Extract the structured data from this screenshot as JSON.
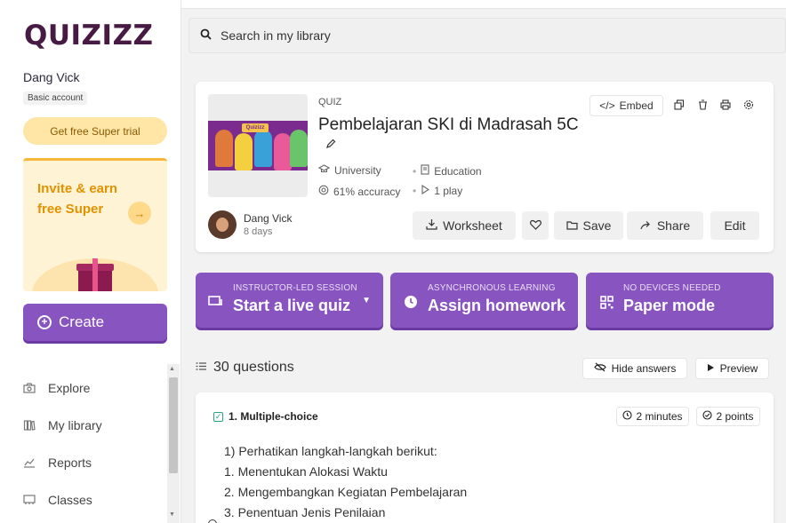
{
  "sidebar": {
    "logo": "QUIZIZZ",
    "user_name": "Dang Vick",
    "account_type": "Basic account",
    "trial_button": "Get free Super trial",
    "invite_text": "Invite & earn free Super",
    "create_button": "Create",
    "nav": [
      {
        "label": "Explore",
        "icon": "compass-icon"
      },
      {
        "label": "My library",
        "icon": "library-icon"
      },
      {
        "label": "Reports",
        "icon": "reports-icon"
      },
      {
        "label": "Classes",
        "icon": "classes-icon"
      }
    ]
  },
  "search": {
    "placeholder": "Search in my library"
  },
  "quiz": {
    "type": "QUIZ",
    "title": "Pembelajaran SKI di Madrasah 5C",
    "grade": "University",
    "subject": "Education",
    "accuracy": "61% accuracy",
    "plays": "1 play",
    "thumbnail_sign": "Quizizz",
    "author": "Dang Vick",
    "time": "8 days",
    "embed_label": "Embed",
    "worksheet_label": "Worksheet",
    "save_label": "Save",
    "share_label": "Share",
    "edit_label": "Edit"
  },
  "modes": [
    {
      "sub": "INSTRUCTOR-LED SESSION",
      "main": "Start a live quiz"
    },
    {
      "sub": "ASYNCHRONOUS LEARNING",
      "main": "Assign homework"
    },
    {
      "sub": "NO DEVICES NEEDED",
      "main": "Paper mode"
    }
  ],
  "questions": {
    "count_label": "30 questions",
    "hide_answers": "Hide answers",
    "preview": "Preview",
    "first": {
      "heading": "1. Multiple-choice",
      "time": "2 minutes",
      "points": "2 points",
      "lines": [
        "1) Perhatikan langkah-langkah berikut:",
        "1. Menentukan Alokasi Waktu",
        "2. Mengembangkan Kegiatan Pembelajaran",
        "3. Penentuan Jenis Penilaian"
      ]
    }
  },
  "colors": {
    "brand": "#461a42",
    "accent": "#8854c0",
    "trial": "#ffe6a7",
    "invite": "#e29200"
  }
}
